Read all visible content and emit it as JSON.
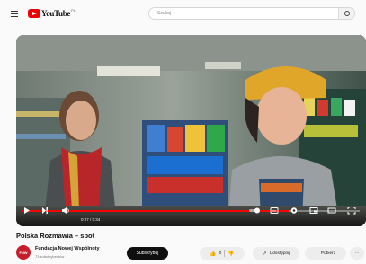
{
  "header": {
    "logo_text": "YouTube",
    "logo_country": "PL",
    "search_placeholder": "Szukaj"
  },
  "player": {
    "time_display": "0:27 / 0:34",
    "progress": 0.79
  },
  "video": {
    "title": "Polska Rozmawia – spot"
  },
  "channel": {
    "avatar_text": "FNW",
    "name": "Fundacja Nowej Wspólnoty",
    "subscribers": "73 subskrybentów",
    "subscribe_label": "Subskrybuj"
  },
  "actions": {
    "like_count": "0",
    "share_label": "Udostępnij",
    "download_label": "Pobierz",
    "more_label": "···"
  },
  "colors": {
    "accent_red": "#ff0000",
    "brand_red": "#e00000",
    "subscribe_bg": "#0f0f0f",
    "beanie": "#e0a62a",
    "scarf": "#b8262a"
  }
}
